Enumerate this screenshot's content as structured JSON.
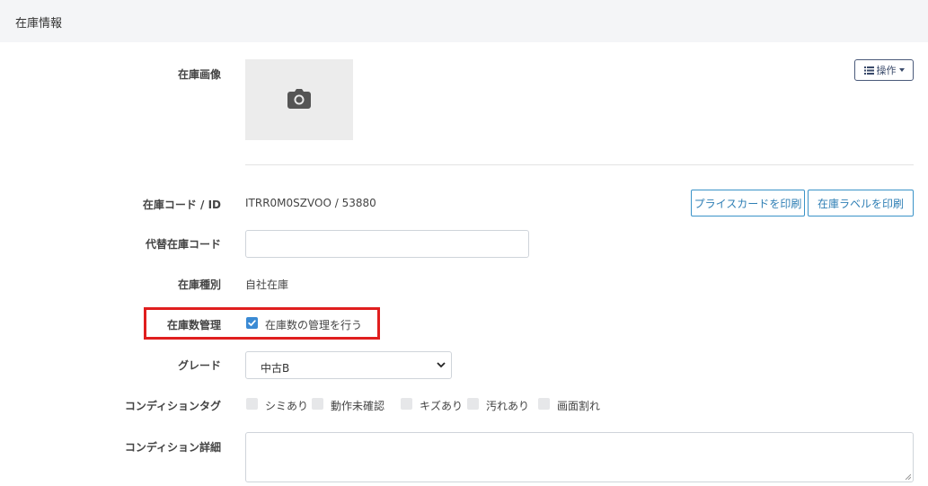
{
  "section": {
    "title": "在庫情報"
  },
  "image_field": {
    "label": "在庫画像",
    "icon": "camera-icon"
  },
  "operations": {
    "label": "操作",
    "icon": "list-icon"
  },
  "stock_code": {
    "label": "在庫コード / ID",
    "value": "ITRR0M0SZVOO / 53880",
    "print_price_card": "プライスカードを印刷",
    "print_stock_label": "在庫ラベルを印刷"
  },
  "alt_code": {
    "label": "代替在庫コード",
    "value": "",
    "placeholder": ""
  },
  "stock_type": {
    "label": "在庫種別",
    "value": "自社在庫"
  },
  "quantity_mgmt": {
    "label": "在庫数管理",
    "checkbox_label": "在庫数の管理を行う",
    "checked": true
  },
  "grade": {
    "label": "グレード",
    "selected": "中古B"
  },
  "condition_tags": {
    "label": "コンディションタグ",
    "items": [
      {
        "label": "シミあり",
        "checked": false
      },
      {
        "label": "動作未確認",
        "checked": false
      },
      {
        "label": "キズあり",
        "checked": false
      },
      {
        "label": "汚れあり",
        "checked": false
      },
      {
        "label": "画面割れ",
        "checked": false
      }
    ]
  },
  "condition_detail": {
    "label": "コンディション詳細",
    "value": ""
  },
  "colors": {
    "accent": "#3a93c8",
    "checkbox": "#3a8ad4",
    "highlight": "#e01e1e",
    "header_bg": "#f4f5f7"
  }
}
